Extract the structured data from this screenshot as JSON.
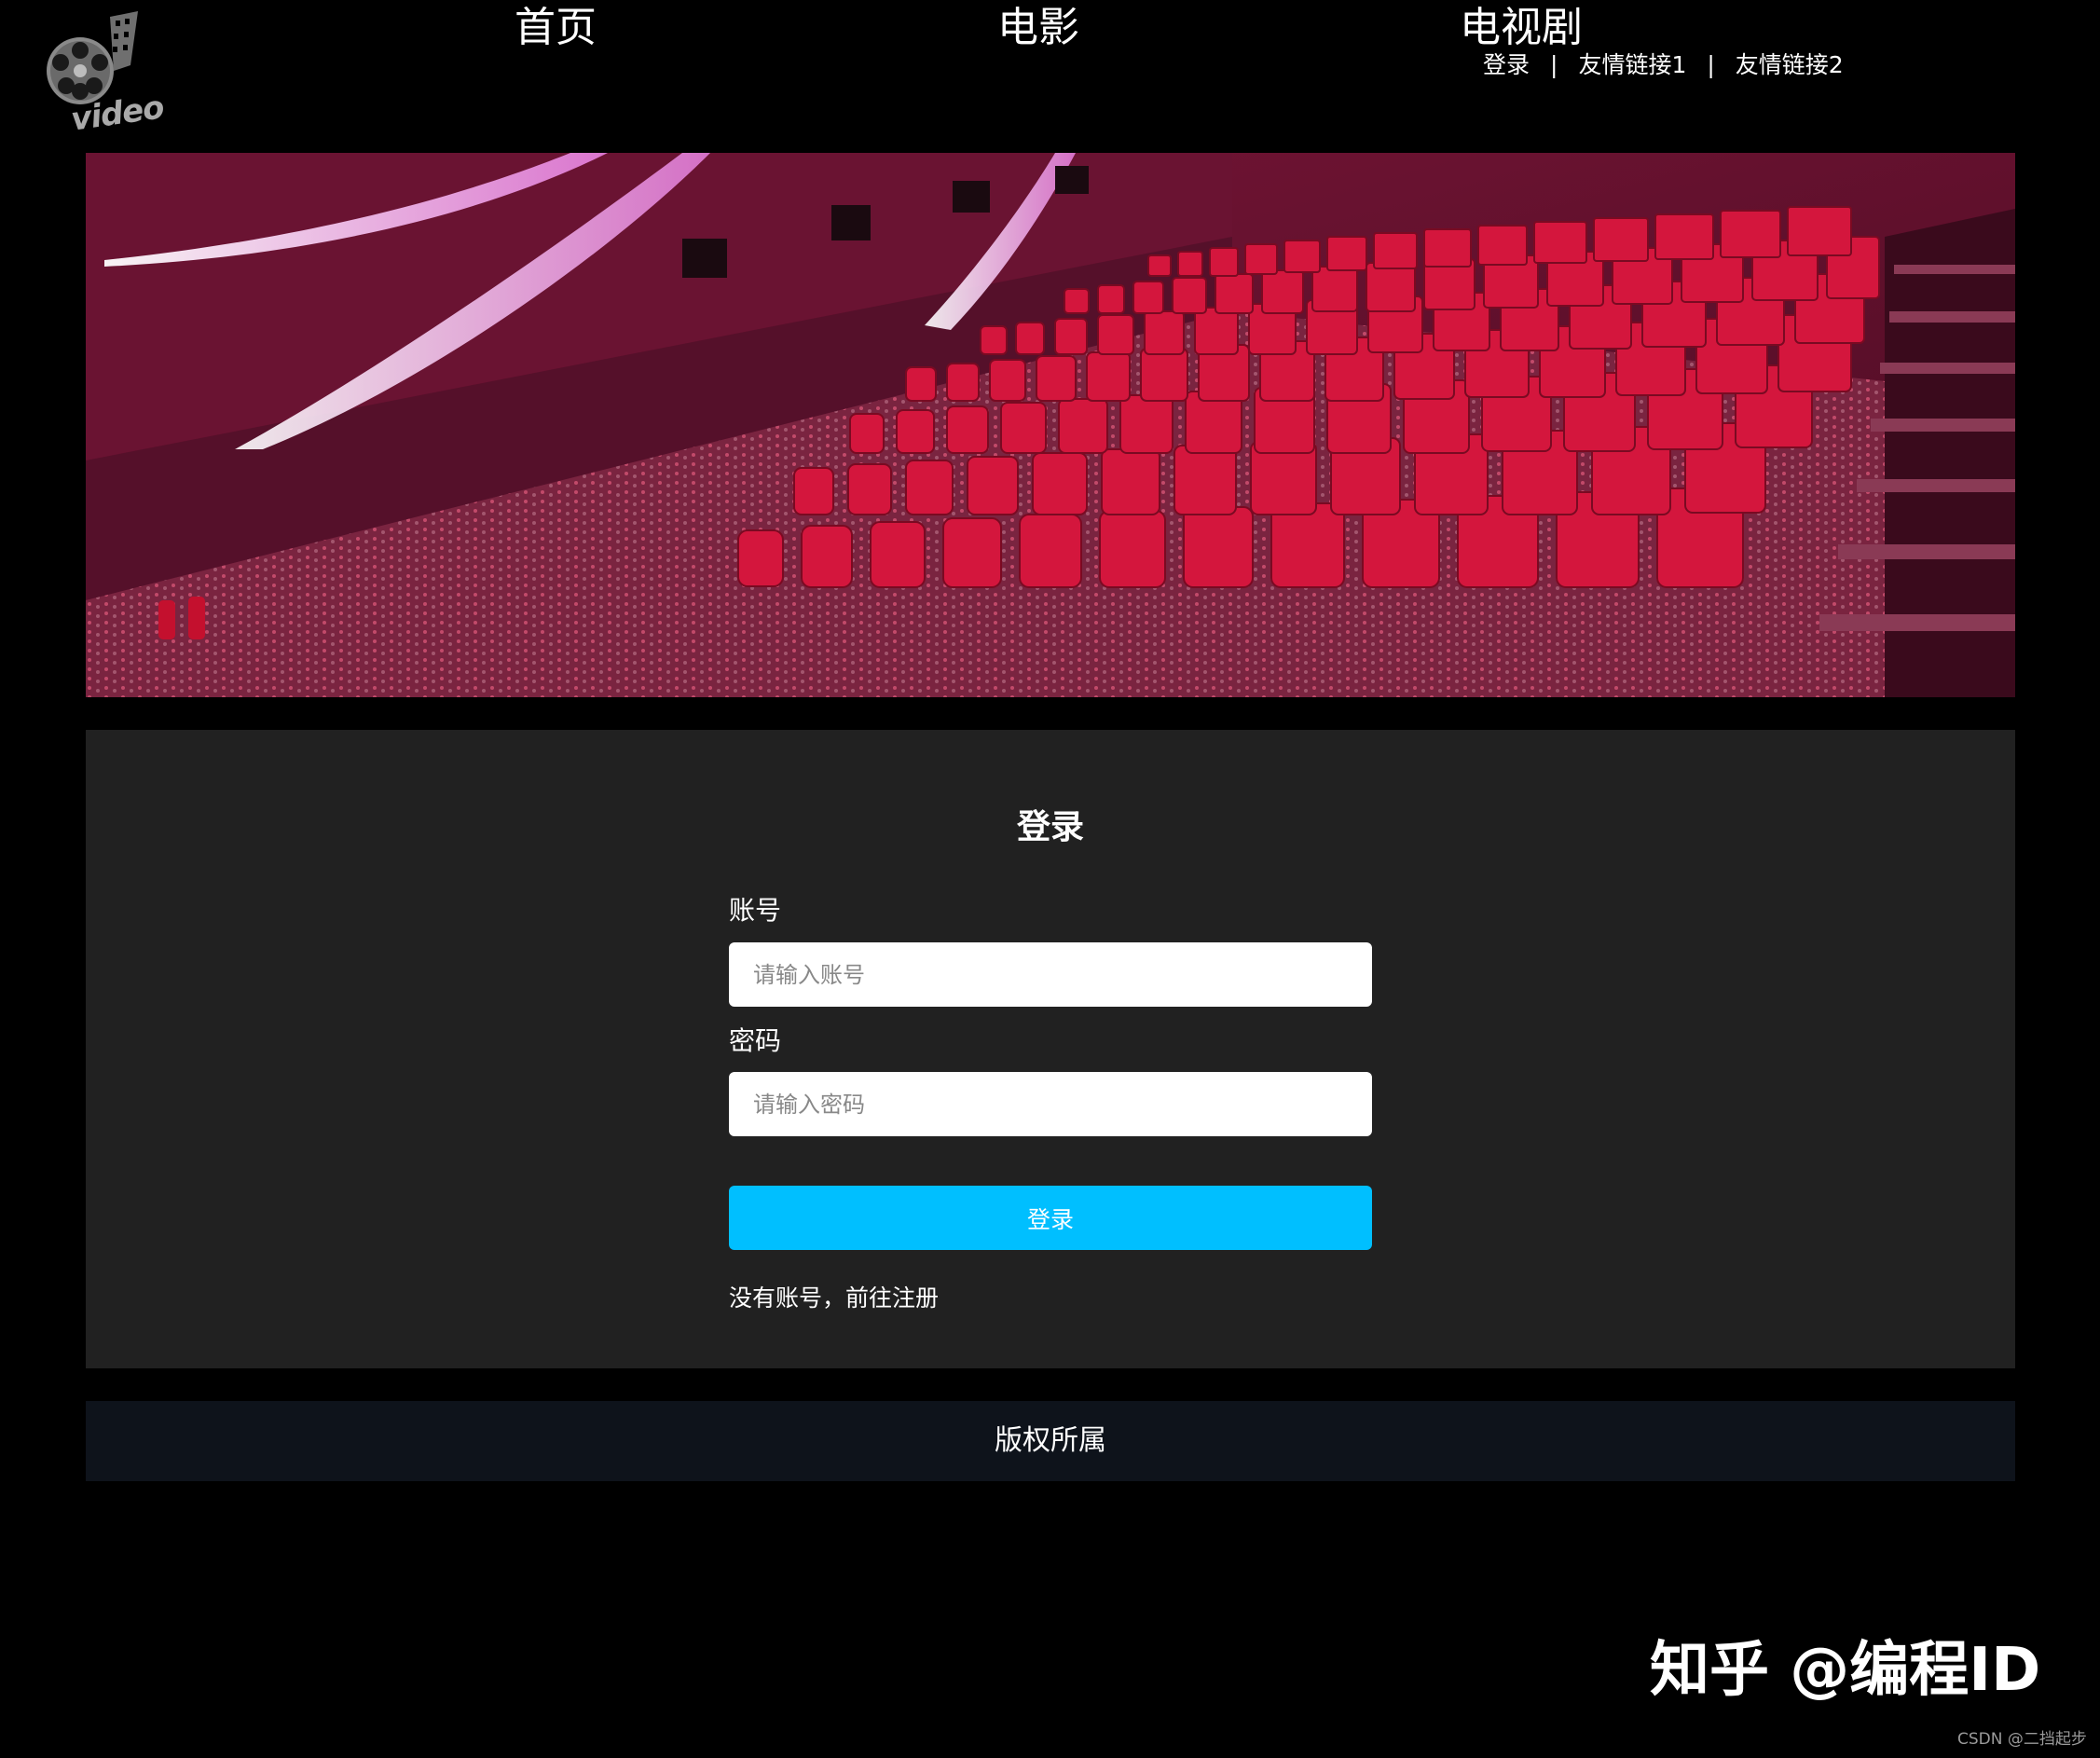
{
  "header": {
    "logo_text": "video",
    "nav": {
      "home": "首页",
      "movie": "电影",
      "tv": "电视剧"
    },
    "top_links": {
      "login": "登录",
      "friend_link_1": "友情链接1",
      "friend_link_2": "友情链接2",
      "separator": "|"
    }
  },
  "login_form": {
    "title": "登录",
    "account_label": "账号",
    "account_placeholder": "请输入账号",
    "account_value": "",
    "password_label": "密码",
    "password_placeholder": "请输入密码",
    "password_value": "",
    "submit_label": "登录",
    "register_text": "没有账号，前往注册"
  },
  "footer": {
    "copyright": "版权所属"
  },
  "watermarks": {
    "zhihu": "知乎 @编程ID",
    "csdn": "CSDN @二挡起步"
  },
  "colors": {
    "background": "#000000",
    "panel": "#212121",
    "footer": "#0e131b",
    "button": "#00bfff",
    "seat_red": "#d4163d"
  },
  "icons": {
    "logo": "film-reel-icon",
    "banner": "cinema-hall-image"
  }
}
